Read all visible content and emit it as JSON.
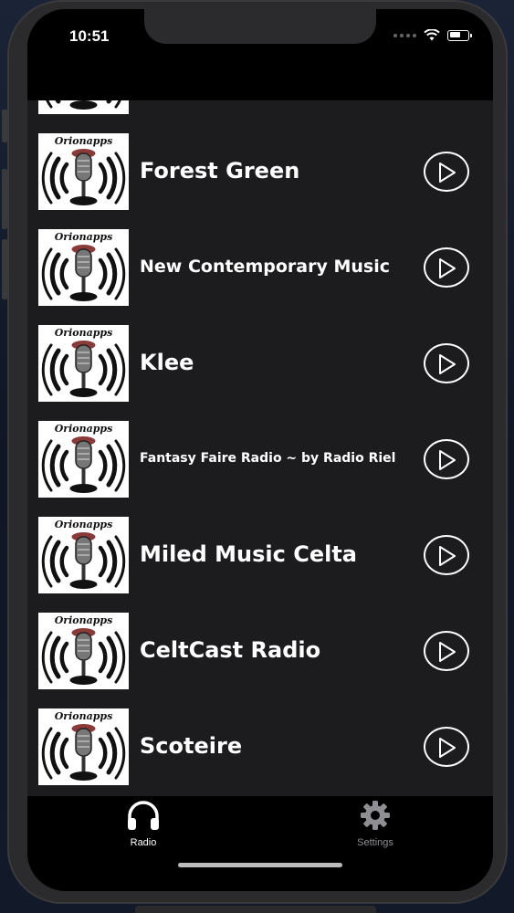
{
  "status_bar": {
    "time": "10:51"
  },
  "logo_text": "Orionapps",
  "stations": [
    {
      "name": "Forest Green"
    },
    {
      "name": "New Contemporary Music"
    },
    {
      "name": "Klee"
    },
    {
      "name": "Fantasy Faire Radio ~ by Radio Riel"
    },
    {
      "name": "Miled Music Celta"
    },
    {
      "name": "CeltCast Radio"
    },
    {
      "name": "Scoteire"
    }
  ],
  "tabs": [
    {
      "label": "Radio",
      "icon": "headphones-icon",
      "active": true
    },
    {
      "label": "Settings",
      "icon": "gear-icon",
      "active": false
    }
  ],
  "colors": {
    "list_background": "#1c1c1e",
    "tab_active": "#ffffff",
    "tab_inactive": "#8e8e93"
  }
}
